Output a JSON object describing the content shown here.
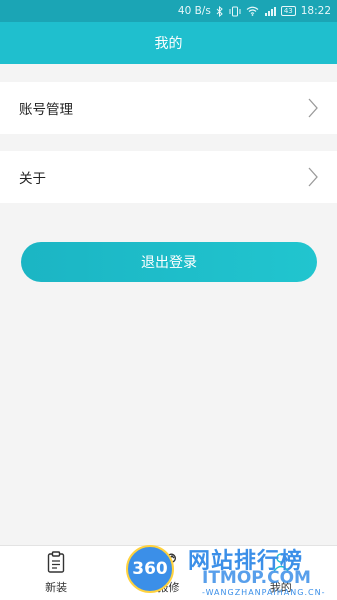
{
  "status_bar": {
    "network_speed": "40 B/s",
    "battery": "43",
    "time": "18:22"
  },
  "header": {
    "title": "我的"
  },
  "menu": {
    "items": [
      {
        "label": "账号管理",
        "icon": "chevron-right-icon"
      },
      {
        "label": "关于",
        "icon": "chevron-right-icon"
      }
    ]
  },
  "logout_button": {
    "label": "退出登录"
  },
  "tab_bar": {
    "tabs": [
      {
        "label": "新装",
        "icon": "clipboard-icon"
      },
      {
        "label": "报修",
        "icon": "wrench-icon"
      },
      {
        "label": "我的",
        "icon": "user-icon"
      }
    ]
  },
  "watermark": {
    "badge": "360",
    "title_cn": "网站排行榜",
    "title_en": "ITMOP.COM",
    "subtitle": "-WANGZHANPAIHANG.CN-"
  },
  "colors": {
    "accent": "#1fbfce",
    "status_bar": "#1ba5b5",
    "background": "#f4f4f4"
  }
}
